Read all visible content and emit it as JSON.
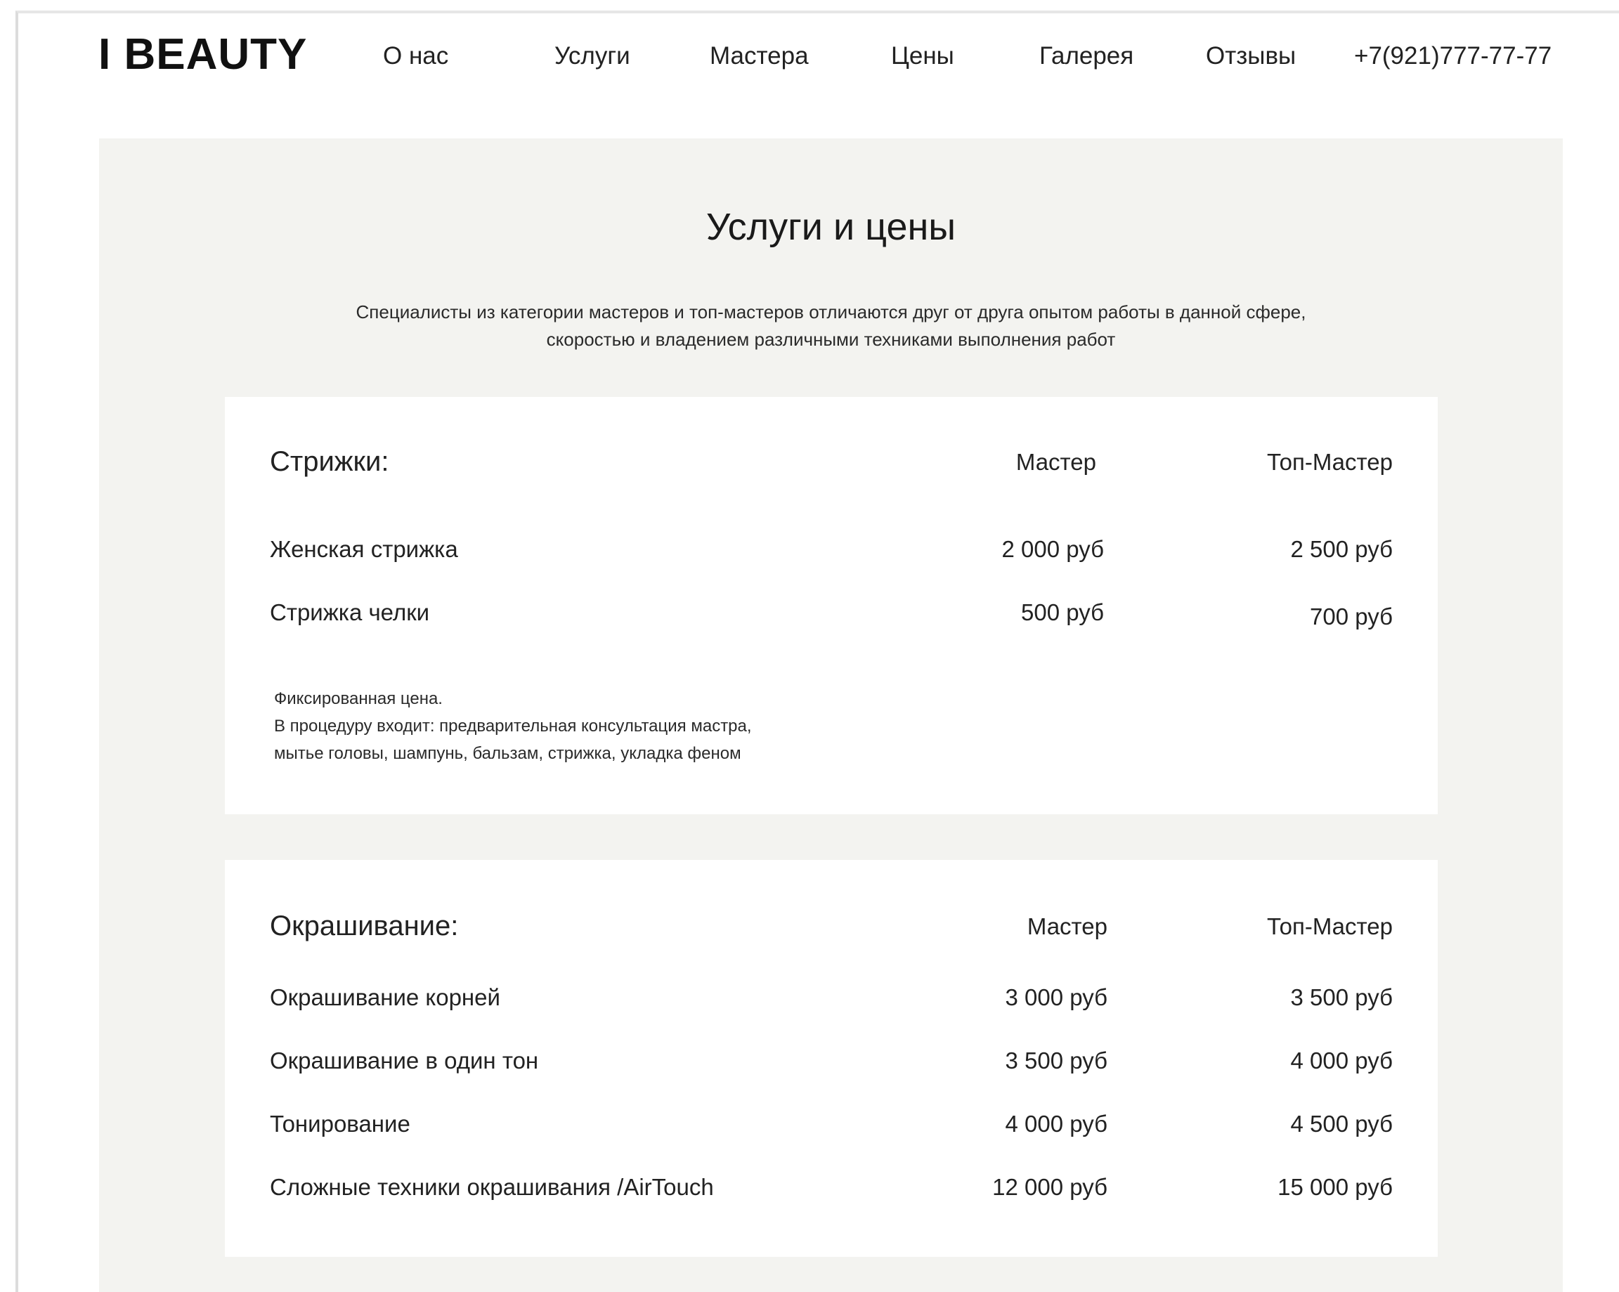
{
  "header": {
    "logo": "I BEAUTY",
    "nav": [
      "О нас",
      "Услуги",
      "Мастера",
      "Цены",
      "Галерея",
      "Отзывы"
    ],
    "phone": "+7(921)777-77-77"
  },
  "section": {
    "title": "Услуги и цены",
    "subtitle_lines": [
      "Специалисты из категории мастеров и топ-мастеров отличаются друг от друга опытом работы в данной сфере,",
      "скоростью и владением различными техниками выполнения работ"
    ]
  },
  "categories": [
    {
      "title": "Стрижки:",
      "col_master": "Мастер",
      "col_top": "Топ-Мастер",
      "rows": [
        {
          "name": "Женская стрижка",
          "master": "2 000 руб",
          "top": "2 500 руб"
        },
        {
          "name": "Стрижка челки",
          "master": "500 руб",
          "top": "700 руб"
        }
      ],
      "note_lines": [
        "Фиксированная цена.",
        "В процедуру входит: предварительная консультация мастра,",
        "мытье головы, шампунь, бальзам, стрижка, укладка феном"
      ]
    },
    {
      "title": "Окрашивание:",
      "col_master": "Мастер",
      "col_top": "Топ-Мастер",
      "rows": [
        {
          "name": "Окрашивание корней",
          "master": "3 000 руб",
          "top": "3 500 руб"
        },
        {
          "name": "Окрашивание в один тон",
          "master": "3 500 руб",
          "top": "4 000 руб"
        },
        {
          "name": "Тонирование",
          "master": "4 000 руб",
          "top": "4 500 руб"
        },
        {
          "name": "Сложные техники окрашивания /AirTouch",
          "master": "12 000 руб",
          "top": "15 000 руб"
        }
      ]
    }
  ]
}
